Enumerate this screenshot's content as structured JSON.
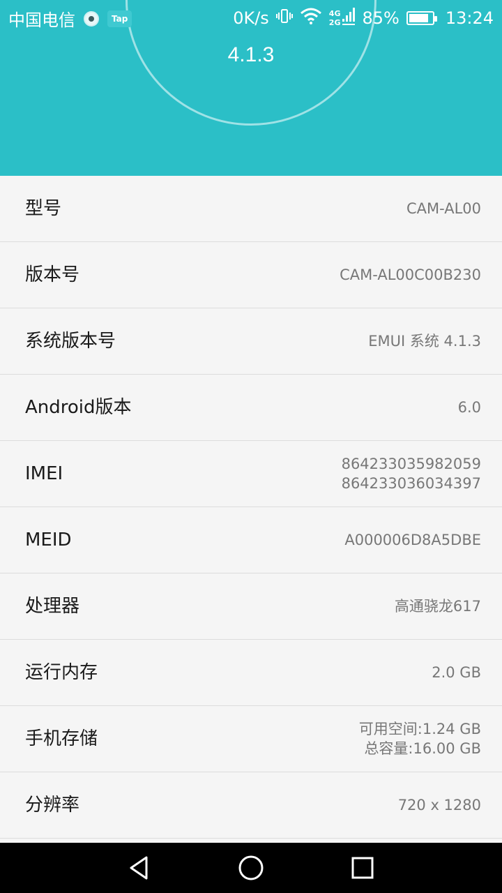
{
  "status_bar": {
    "carrier": "中国电信",
    "tap_badge": "Tap",
    "net_speed": "0K/s",
    "net_4g": "4G",
    "net_2g": "2G",
    "battery_percent": "85%",
    "battery_level": 0.85,
    "time": "13:24"
  },
  "header": {
    "version": "4.1.3"
  },
  "rows": [
    {
      "label": "型号",
      "value": "CAM-AL00"
    },
    {
      "label": "版本号",
      "value": "CAM-AL00C00B230"
    },
    {
      "label": "系统版本号",
      "value": "EMUI 系统 4.1.3"
    },
    {
      "label": "Android版本",
      "value": "6.0"
    },
    {
      "label": "IMEI",
      "value": "864233035982059",
      "value2": "864233036034397"
    },
    {
      "label": "MEID",
      "value": "A000006D8A5DBE"
    },
    {
      "label": "处理器",
      "value": "高通骁龙617"
    },
    {
      "label": "运行内存",
      "value": "2.0 GB"
    },
    {
      "label": "手机存储",
      "value": "可用空间:1.24 GB",
      "value2": "总容量:16.00 GB"
    },
    {
      "label": "分辨率",
      "value": "720 x 1280"
    }
  ],
  "nav": {
    "back_icon": "back-triangle",
    "home_icon": "home-circle",
    "recents_icon": "recents-square"
  }
}
